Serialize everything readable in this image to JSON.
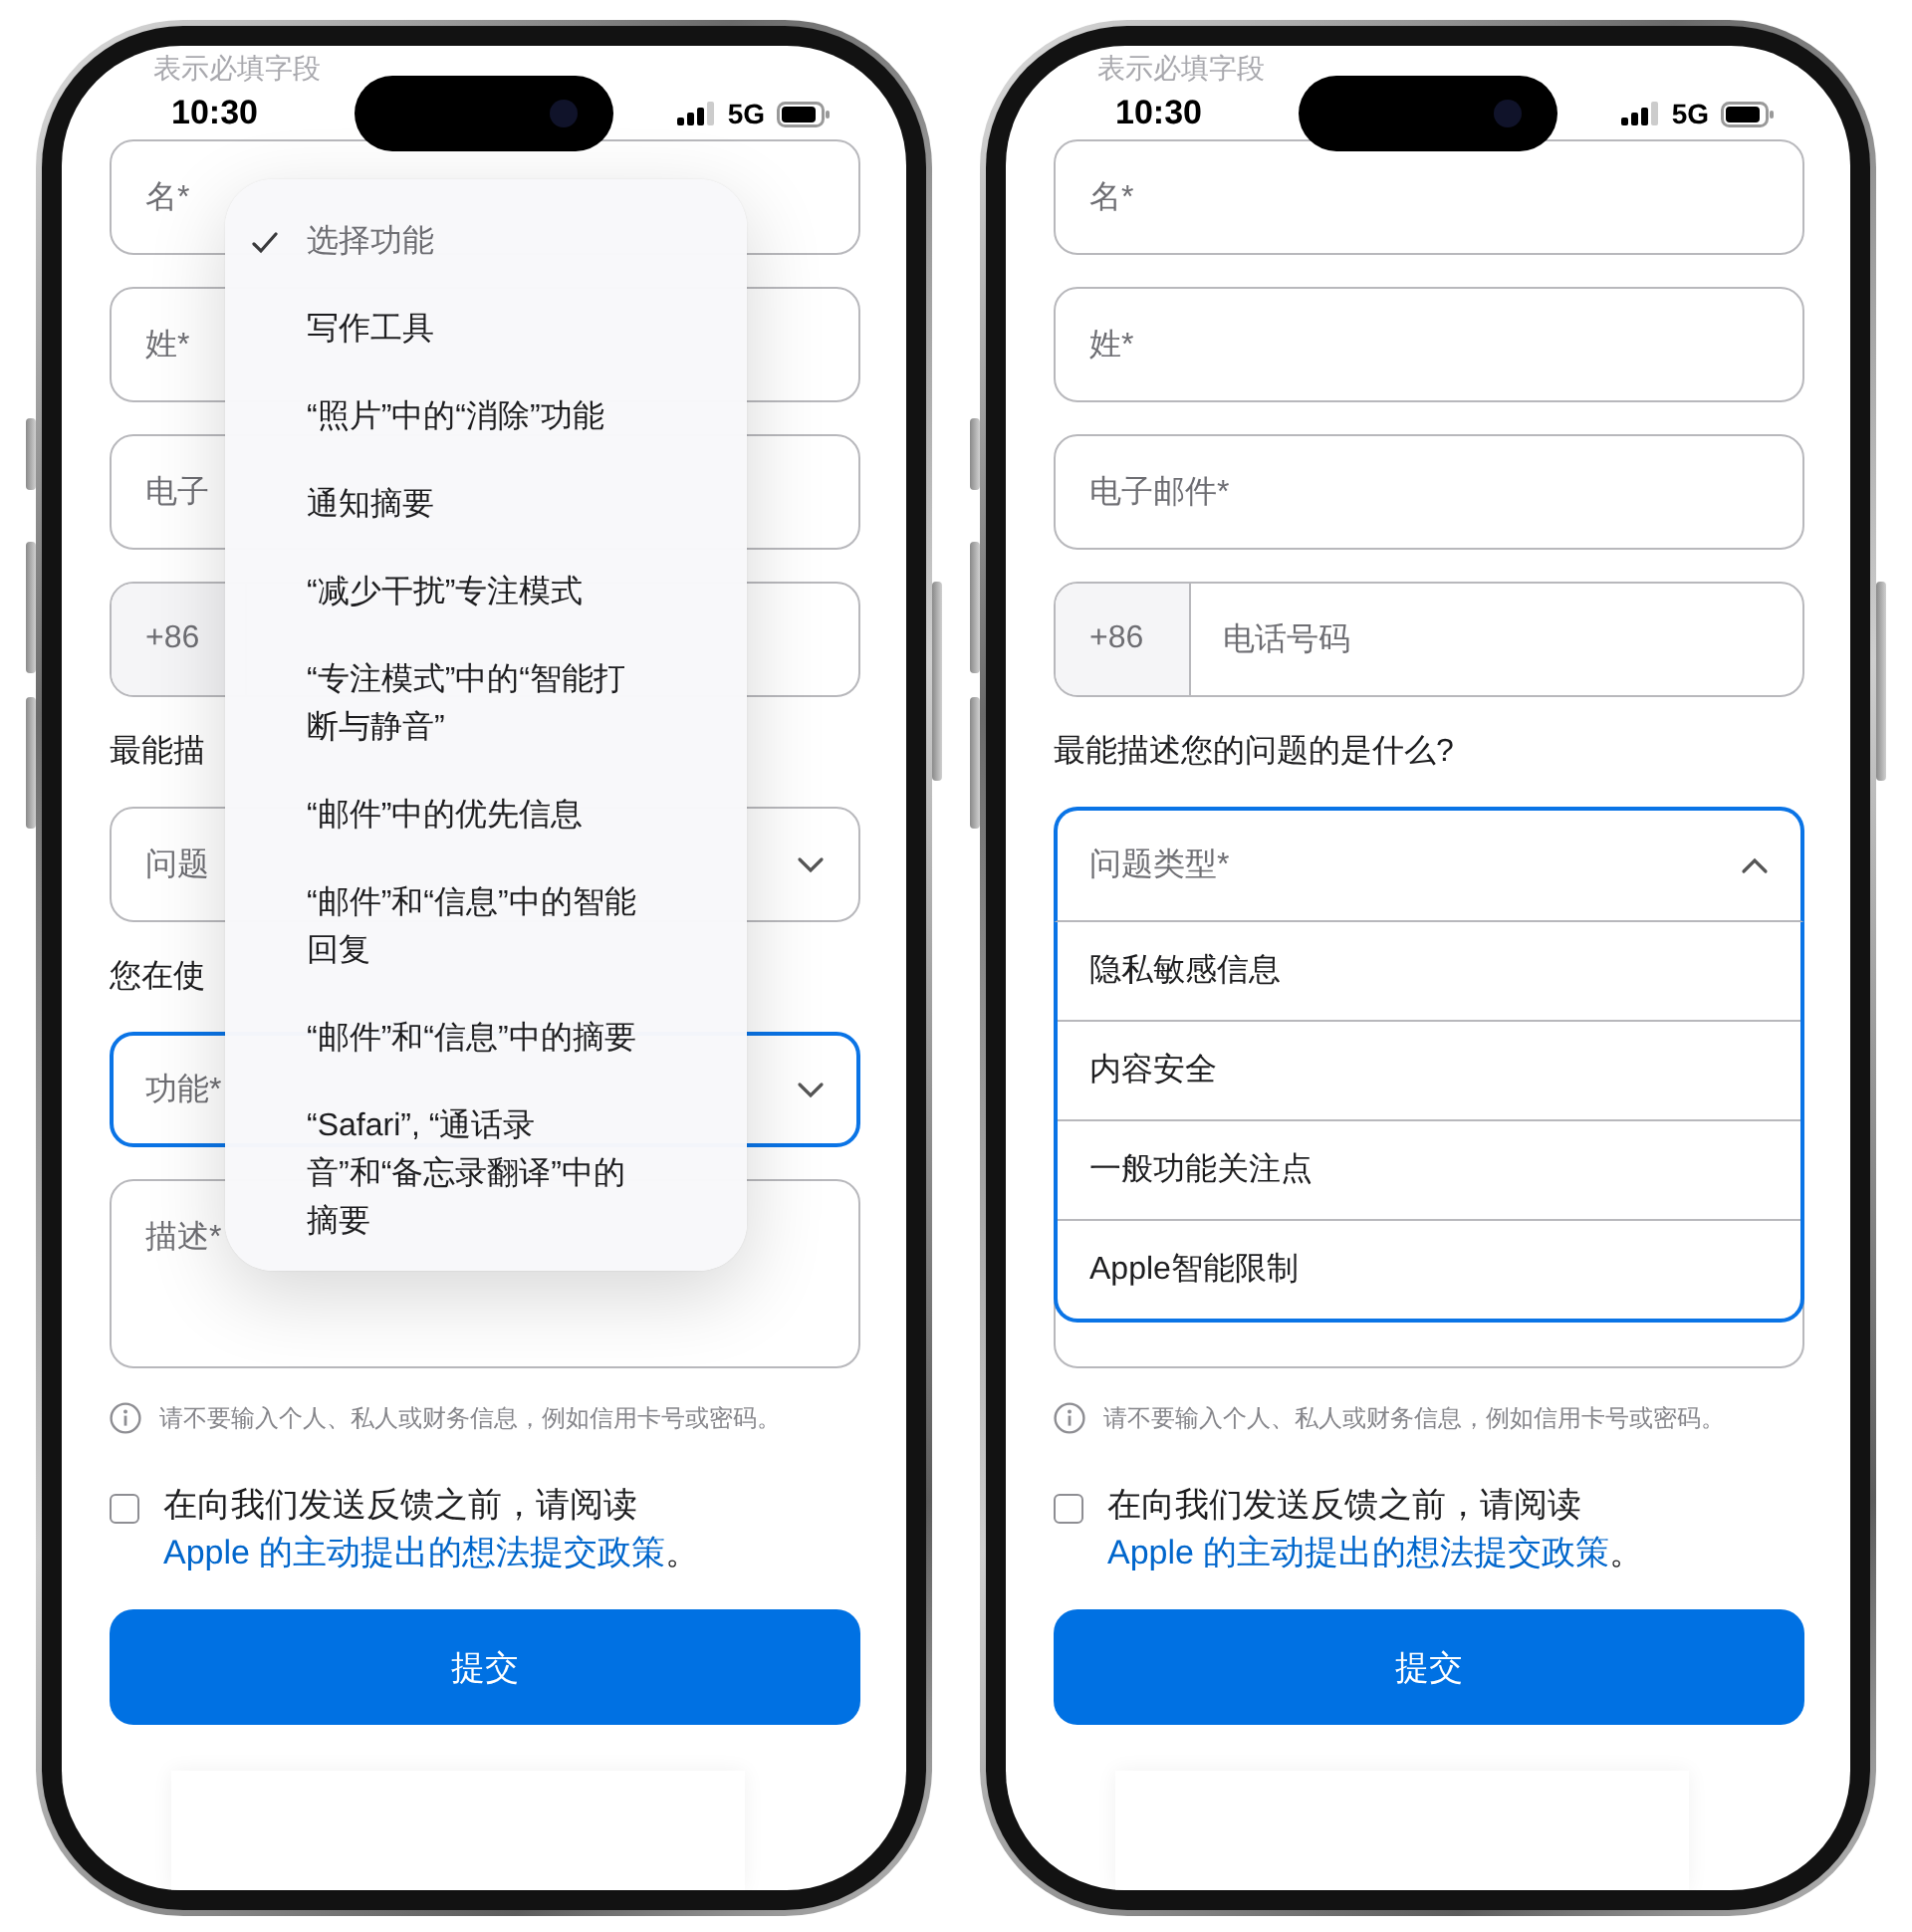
{
  "phones": [
    {
      "header": "表示必填字段",
      "status": {
        "time": "10:30",
        "network": "5G"
      },
      "form": [
        {
          "kind": "text",
          "placeholder": "名*"
        },
        {
          "kind": "text",
          "placeholder": "姓*"
        },
        {
          "kind": "text",
          "placeholder": "电子"
        },
        {
          "kind": "phone",
          "code": "+86"
        },
        {
          "kind": "label",
          "text": "最能描"
        },
        {
          "kind": "select",
          "placeholder": "问题",
          "focused": false,
          "expanded": false
        },
        {
          "kind": "label",
          "text": "您在使"
        },
        {
          "kind": "select",
          "placeholder": "功能*",
          "focused": true,
          "expanded": false
        },
        {
          "kind": "textarea",
          "placeholder": "描述*"
        }
      ],
      "note": "请不要输入个人、私人或财务信息，例如信用卡号或密码。",
      "consent": {
        "checked": false,
        "text": "在向我们发送反馈之前，请阅读",
        "link": "Apple 的主动提出的想法提交政策",
        "end": "。"
      },
      "submit": "提交",
      "menu": {
        "items": [
          {
            "label": "选择功能",
            "selected": true
          },
          {
            "label": "写作工具",
            "selected": false
          },
          {
            "label": "“照片”中的“消除”功能",
            "selected": false
          },
          {
            "label": "通知摘要",
            "selected": false
          },
          {
            "label": "“减少干扰”专注模式",
            "selected": false
          },
          {
            "label": "“专注模式”中的“智能打断与静音”",
            "selected": false
          },
          {
            "label": "“邮件”中的优先信息",
            "selected": false
          },
          {
            "label": "“邮件”和“信息”中的智能回复",
            "selected": false
          },
          {
            "label": "“邮件”和“信息”中的摘要",
            "selected": false
          },
          {
            "label": "“Safari”, “通话录音”和“备忘录翻译”中的摘要",
            "selected": false
          }
        ]
      }
    },
    {
      "header": "表示必填字段",
      "status": {
        "time": "10:30",
        "network": "5G"
      },
      "form": [
        {
          "kind": "text",
          "placeholder": "名*"
        },
        {
          "kind": "text",
          "placeholder": "姓*"
        },
        {
          "kind": "text",
          "placeholder": "电子邮件*"
        },
        {
          "kind": "phone",
          "code": "+86",
          "placeholder": "电话号码"
        },
        {
          "kind": "label",
          "text": "最能描述您的问题的是什么?"
        },
        {
          "kind": "select",
          "placeholder": "问题类型*",
          "focused": true,
          "expanded": true,
          "options": [
            {
              "label": "隐私敏感信息",
              "selected": false
            },
            {
              "label": "内容安全",
              "selected": false
            },
            {
              "label": "一般功能关注点",
              "selected": false
            },
            {
              "label": "Apple智能限制",
              "selected": false
            }
          ]
        },
        {
          "kind": "textarea"
        }
      ],
      "note": "请不要输入个人、私人或财务信息，例如信用卡号或密码。",
      "consent": {
        "checked": false,
        "text": "在向我们发送反馈之前，请阅读",
        "link": "Apple 的主动提出的想法提交政策",
        "end": "。"
      },
      "submit": "提交"
    }
  ]
}
